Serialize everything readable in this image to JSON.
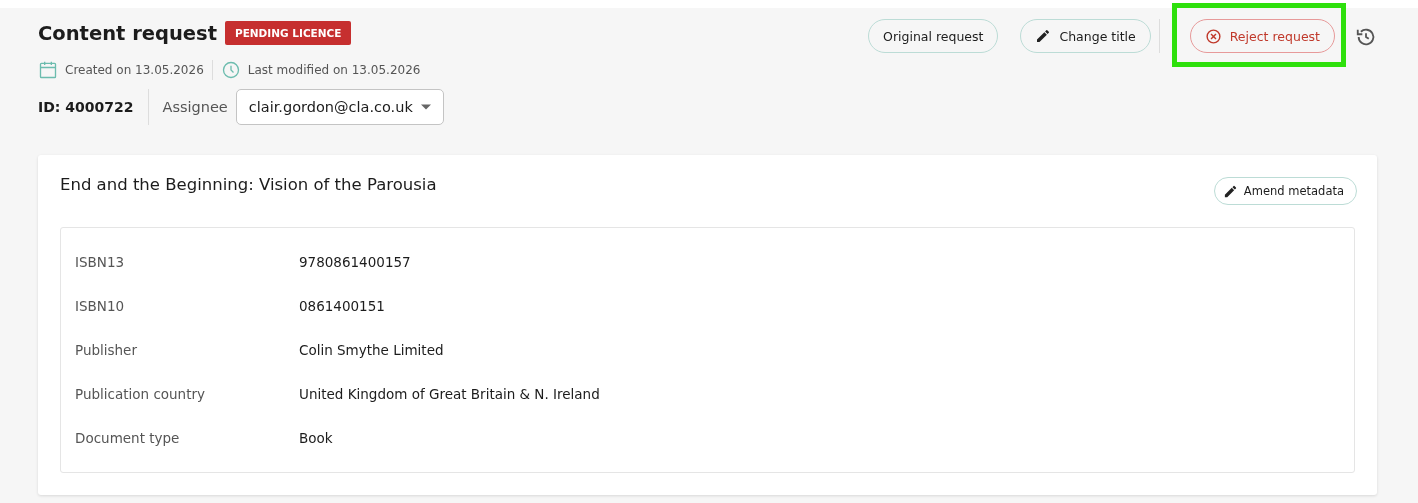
{
  "header": {
    "title": "Content request",
    "status_badge": "PENDING LICENCE",
    "created": "Created on 13.05.2026",
    "modified": "Last modified on 13.05.2026",
    "id": "ID: 4000722",
    "assignee_label": "Assignee",
    "assignee_value": "clair.gordon@cla.co.uk"
  },
  "actions": [
    {
      "kind": "plain",
      "label": "Original request",
      "highlighted": false
    },
    {
      "kind": "edit",
      "label": "Change title",
      "highlighted": false
    },
    {
      "kind": "reject",
      "label": "Reject request",
      "highlighted": true
    }
  ],
  "card": {
    "title": "End and the Beginning: Vision of the Parousia",
    "amend_button": "Amend metadata",
    "fields": [
      {
        "label": "ISBN13",
        "value": "9780861400157"
      },
      {
        "label": "ISBN10",
        "value": "0861400151"
      },
      {
        "label": "Publisher",
        "value": "Colin Smythe Limited"
      },
      {
        "label": "Publication country",
        "value": "United Kingdom of Great Britain & N. Ireland"
      },
      {
        "label": "Document type",
        "value": "Book"
      }
    ]
  }
}
